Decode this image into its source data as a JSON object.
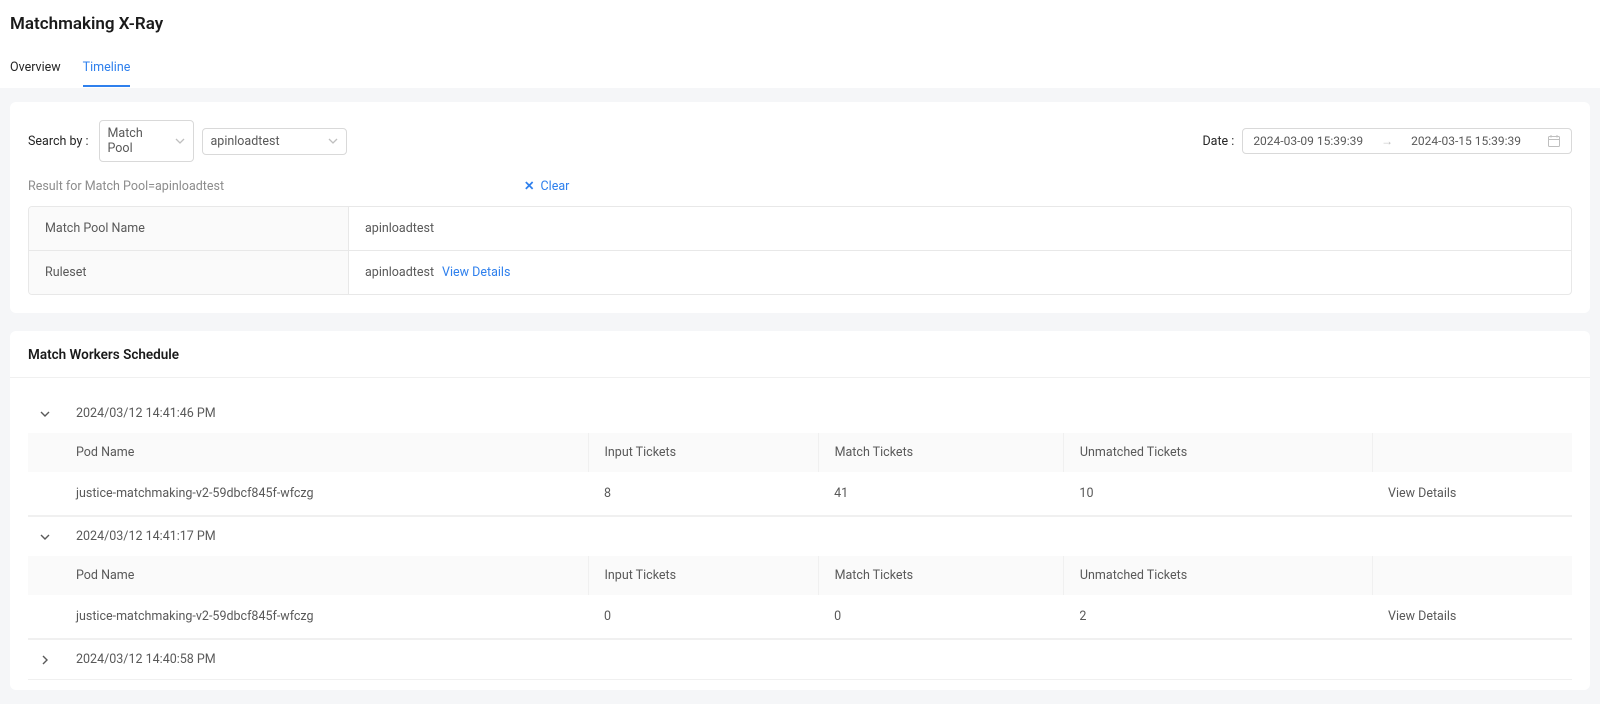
{
  "header": {
    "title": "Matchmaking X-Ray"
  },
  "tabs": {
    "overview": "Overview",
    "timeline": "Timeline",
    "active": "timeline"
  },
  "search": {
    "label": "Search by :",
    "field": "Match Pool",
    "value": "apinloadtest",
    "result_text": "Result for Match Pool=apinloadtest",
    "clear_label": "Clear"
  },
  "date": {
    "label": "Date :",
    "from": "2024-03-09 15:39:39",
    "to": "2024-03-15 15:39:39"
  },
  "poolInfo": {
    "matchPoolName_label": "Match Pool Name",
    "matchPoolName_value": "apinloadtest",
    "ruleset_label": "Ruleset",
    "ruleset_value": "apinloadtest",
    "view_details": "View Details"
  },
  "schedule": {
    "title": "Match Workers Schedule",
    "columns": {
      "podName": "Pod Name",
      "inputTickets": "Input Tickets",
      "matchTickets": "Match Tickets",
      "unmatchedTickets": "Unmatched Tickets"
    },
    "view_details": "View Details",
    "groups": [
      {
        "timestamp": "2024/03/12 14:41:46 PM",
        "expanded": true,
        "rows": [
          {
            "podName": "justice-matchmaking-v2-59dbcf845f-wfczg",
            "inputTickets": "8",
            "matchTickets": "41",
            "unmatchedTickets": "10"
          }
        ]
      },
      {
        "timestamp": "2024/03/12 14:41:17 PM",
        "expanded": true,
        "rows": [
          {
            "podName": "justice-matchmaking-v2-59dbcf845f-wfczg",
            "inputTickets": "0",
            "matchTickets": "0",
            "unmatchedTickets": "2"
          }
        ]
      },
      {
        "timestamp": "2024/03/12 14:40:58 PM",
        "expanded": false,
        "rows": []
      }
    ]
  }
}
